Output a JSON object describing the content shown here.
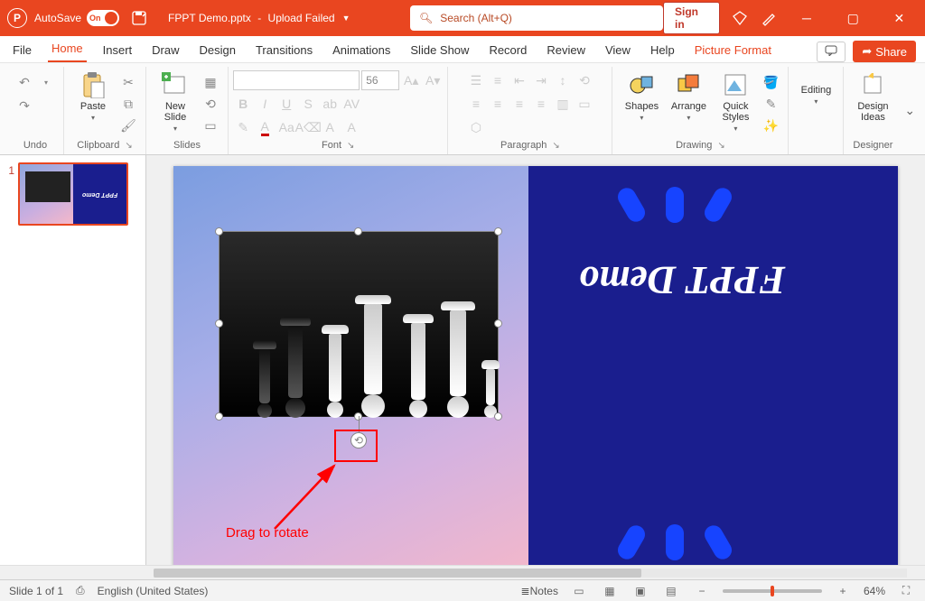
{
  "titlebar": {
    "autosave_label": "AutoSave",
    "autosave_state": "On",
    "filename": "FPPT Demo.pptx",
    "upload_status": "Upload Failed",
    "search_placeholder": "Search (Alt+Q)",
    "signin": "Sign in"
  },
  "tabs": {
    "file": "File",
    "home": "Home",
    "insert": "Insert",
    "draw": "Draw",
    "design": "Design",
    "transitions": "Transitions",
    "animations": "Animations",
    "slideshow": "Slide Show",
    "record": "Record",
    "review": "Review",
    "view": "View",
    "help": "Help",
    "picture_format": "Picture Format",
    "share": "Share"
  },
  "ribbon": {
    "undo": "Undo",
    "clipboard": "Clipboard",
    "paste": "Paste",
    "slides": "Slides",
    "new_slide": "New Slide",
    "font": "Font",
    "font_size": "56",
    "paragraph": "Paragraph",
    "drawing": "Drawing",
    "shapes": "Shapes",
    "arrange": "Arrange",
    "quick_styles": "Quick Styles",
    "editing": "Editing",
    "designer": "Designer",
    "design_ideas": "Design Ideas"
  },
  "thumb": {
    "number": "1"
  },
  "slide": {
    "title": "FPPT Demo",
    "callout": "Drag to rotate"
  },
  "statusbar": {
    "slide_count": "Slide 1 of 1",
    "language": "English (United States)",
    "notes": "Notes",
    "zoom": "64%"
  }
}
